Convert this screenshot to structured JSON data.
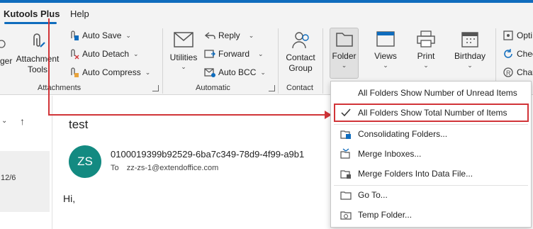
{
  "tabs": [
    {
      "label": "Kutools Plus"
    },
    {
      "label": "Help"
    }
  ],
  "ribbon": {
    "left_partial": "ger",
    "attachments": {
      "attachment_tools": [
        "Attachment",
        "Tools"
      ],
      "auto_save": "Auto Save",
      "auto_detach": "Auto Detach",
      "auto_compress": "Auto Compress",
      "group_label": "Attachments"
    },
    "automatic": {
      "utilities": "Utilities",
      "reply": "Reply",
      "forward": "Forward",
      "auto_bcc": "Auto BCC",
      "group_label": "Automatic"
    },
    "contact": {
      "contact_group": [
        "Contact",
        "Group"
      ],
      "group_label": "Contact"
    },
    "folder": "Folder",
    "views": "Views",
    "print": "Print",
    "birthday": "Birthday",
    "right_partial": [
      "Opti",
      "Chec",
      "Char"
    ]
  },
  "left_pane": {
    "sort_arrow": "↑",
    "date_fragment": "12/6"
  },
  "message": {
    "subject": "test",
    "avatar_initials": "ZS",
    "sender": "0100019399b92529-6ba7c349-78d9-4f99-a9b1",
    "to_label": "To",
    "to_address": "zz-zs-1@extendoffice.com",
    "body": "Hi,"
  },
  "folder_menu": {
    "items": [
      {
        "label": "All Folders Show Number of Unread Items"
      },
      {
        "label": "All Folders Show Total Number of Items"
      },
      {
        "label": "Consolidating Folders..."
      },
      {
        "label": "Merge Inboxes..."
      },
      {
        "label": "Merge Folders Into Data File..."
      },
      {
        "label": "Go To..."
      },
      {
        "label": "Temp Folder..."
      }
    ]
  },
  "colors": {
    "accent": "#0f6cbd",
    "highlight": "#d13438",
    "avatar": "#138a81"
  }
}
